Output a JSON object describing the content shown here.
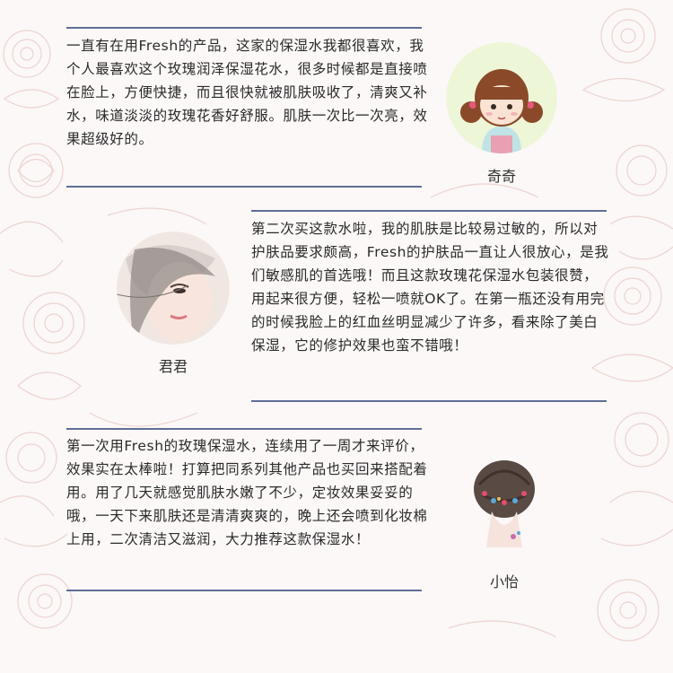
{
  "reviews": [
    {
      "name": "奇奇",
      "text": "一直有在用Fresh的产品，这家的保湿水我都很喜欢，我个人最喜欢这个玫瑰润泽保湿花水，很多时候都是直接喷在脸上，方便快捷，而且很快就被肌肤吸收了，清爽又补水，味道淡淡的玫瑰花香好舒服。肌肤一次比一次亮，效果超级好的。",
      "avatar_icon": "cartoon-girl-pigtails-icon"
    },
    {
      "name": "君君",
      "text": "第二次买这款水啦，我的肌肤是比较易过敏的，所以对护肤品要求颇高，Fresh的护肤品一直让人很放心，是我们敏感肌的首选哦！而且这款玫瑰花保湿水包装很赞，用起来很方便，轻松一喷就OK了。在第一瓶还没有用完的时候我脸上的红血丝明显减少了许多，看来除了美白保湿，它的修护效果也蛮不错哦！",
      "avatar_icon": "illustrated-woman-face-icon"
    },
    {
      "name": "小怡",
      "text": "第一次用Fresh的玫瑰保湿水，连续用了一周才来评价，效果实在太棒啦！打算把同系列其他产品也买回来搭配着用。用了几天就感觉肌肤水嫩了不少，定妆效果妥妥的哦，一天下来肌肤还是清清爽爽的，晚上还会喷到化妆棉上用，二次清洁又滋润，大力推荐这款保湿水！",
      "avatar_icon": "woman-floral-hair-back-icon"
    }
  ],
  "colors": {
    "rule": "#5f6f95",
    "text": "#2a2a2a",
    "floral_line": "#e7c9c6",
    "background": "#fbf8f7"
  }
}
